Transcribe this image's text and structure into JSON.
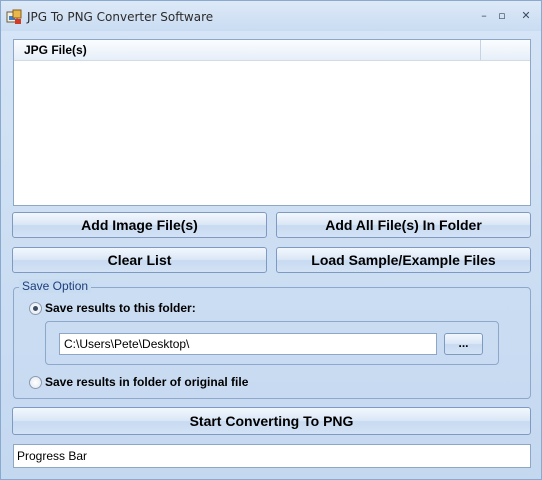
{
  "window": {
    "title": "JPG To PNG Converter Software",
    "minimize_glyph": "–",
    "maximize_glyph": "▫",
    "close_glyph": "✕"
  },
  "file_list": {
    "column_header": "JPG File(s)",
    "items": []
  },
  "buttons": {
    "add_image": "Add Image File(s)",
    "add_all_folder": "Add All File(s) In Folder",
    "clear_list": "Clear List",
    "load_sample": "Load Sample/Example Files",
    "start": "Start Converting To PNG",
    "browse": "..."
  },
  "save_option": {
    "group_title": "Save Option",
    "option_folder": "Save results to this folder:",
    "option_original": "Save results in folder of original file",
    "selected": "folder",
    "folder_path": "C:\\Users\\Pete\\Desktop\\"
  },
  "progress": {
    "label": "Progress Bar",
    "value": 0
  },
  "colors": {
    "window_bg": "#c9dcf2",
    "group_title": "#1f3f7a"
  }
}
